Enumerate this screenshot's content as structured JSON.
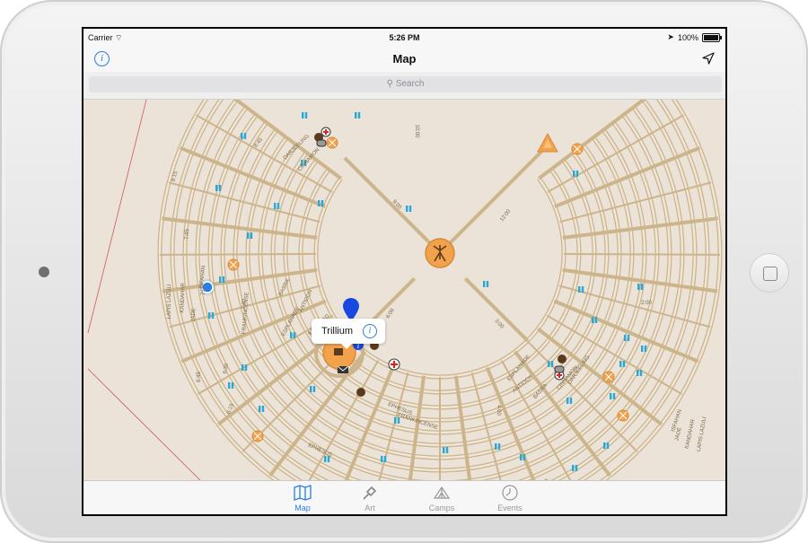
{
  "status": {
    "carrier": "Carrier",
    "time": "5:26 PM",
    "battery": "100%",
    "battery_level": 100
  },
  "nav": {
    "title": "Map",
    "left_icon": "info-icon",
    "right_icon": "location-arrow-icon"
  },
  "search": {
    "placeholder": "Search"
  },
  "callout": {
    "name": "Trillium"
  },
  "colors": {
    "accent": "#2a7de1",
    "street": "#cdb58b",
    "ground": "#ebe2d8",
    "poi": "#f2a24a"
  },
  "streets": {
    "left": [
      "ESPLANADE",
      "ANTIOCH",
      "BASRA",
      "CINNAMON",
      "DARJEELING",
      "FRANKINCENSE",
      "JADE",
      "KANDAHAR",
      "LAPIS LAZULI",
      "ISFAHAN",
      "EPHESUS",
      "GOLD",
      "HAIFA"
    ],
    "right": [
      "ESPLANADE",
      "ANTIOCH",
      "BASRA",
      "CINNAMON",
      "DARJEELING",
      "EPHESUS",
      "FRANKINCENSE",
      "GOLD",
      "HAIFA",
      "ISFAHAN",
      "JADE",
      "KANDAHAR",
      "LAPIS LAZULI"
    ],
    "clock": [
      "2:00",
      "3:00",
      "4:00",
      "6:00",
      "6:45",
      "7:00",
      "7:45",
      "8:15",
      "8:45",
      "9:00",
      "10:00",
      "12:00",
      "6:30",
      "6:15",
      "7:30"
    ],
    "center_road": "6:00 ROAD"
  },
  "tabs": [
    {
      "label": "Map",
      "icon": "map-icon",
      "active": true
    },
    {
      "label": "Art",
      "icon": "art-icon",
      "active": false
    },
    {
      "label": "Camps",
      "icon": "camps-icon",
      "active": false
    },
    {
      "label": "Events",
      "icon": "events-clock-icon",
      "active": false
    }
  ]
}
